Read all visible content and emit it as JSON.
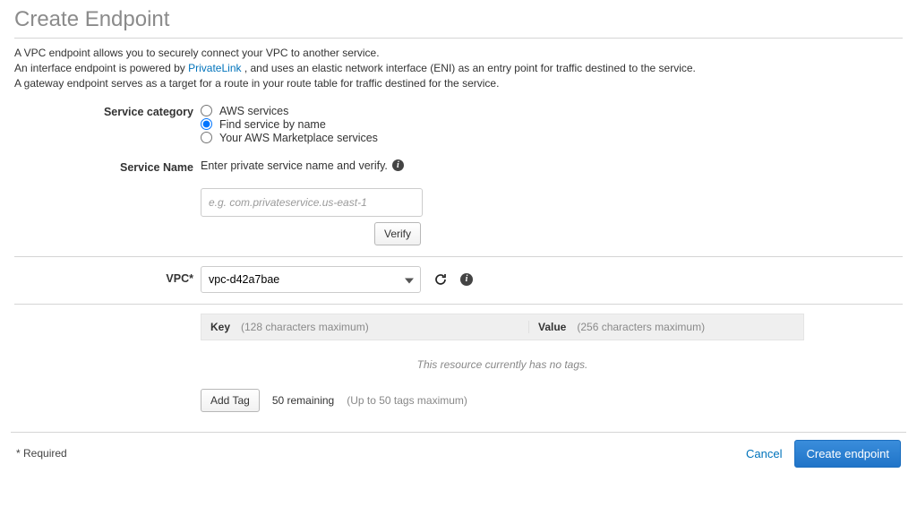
{
  "title": "Create Endpoint",
  "intro": {
    "line1": "A VPC endpoint allows you to securely connect your VPC to another service.",
    "line2a": "An interface endpoint is powered by ",
    "privatelink": "PrivateLink",
    "line2b": " , and uses an elastic network interface (ENI) as an entry point for traffic destined to the service.",
    "line3": "A gateway endpoint serves as a target for a route in your route table for traffic destined for the service."
  },
  "labels": {
    "service_category": "Service category",
    "service_name": "Service Name",
    "vpc": "VPC*"
  },
  "service_category": {
    "options": [
      {
        "label": "AWS services",
        "selected": false
      },
      {
        "label": "Find service by name",
        "selected": true
      },
      {
        "label": "Your AWS Marketplace services",
        "selected": false
      }
    ]
  },
  "service_name": {
    "prompt": "Enter private service name and verify.",
    "placeholder": "e.g. com.privateservice.us-east-1",
    "verify": "Verify"
  },
  "vpc": {
    "value": "vpc-d42a7bae"
  },
  "tags": {
    "key_header": "Key",
    "key_hint": "(128 characters maximum)",
    "value_header": "Value",
    "value_hint": "(256 characters maximum)",
    "empty": "This resource currently has no tags.",
    "add": "Add Tag",
    "remaining": "50 remaining",
    "max_hint": "(Up to 50 tags maximum)"
  },
  "footer": {
    "required": "* Required",
    "cancel": "Cancel",
    "create": "Create endpoint"
  }
}
